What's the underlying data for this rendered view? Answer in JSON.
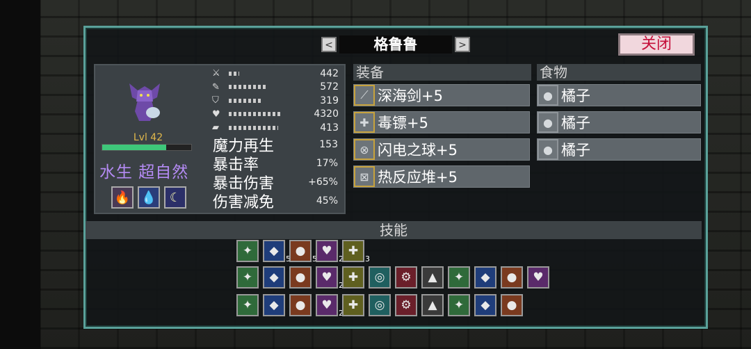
{
  "title": "格鲁鲁",
  "nav": {
    "prev": "<",
    "next": ">"
  },
  "close_label": "关闭",
  "character": {
    "level": "Lvl 42",
    "hp_fraction": 0.72,
    "traits": "水生 超自然",
    "stats": [
      {
        "icon": "sword-icon",
        "value": "442",
        "fill": 0.15
      },
      {
        "icon": "wrench-icon",
        "value": "572",
        "fill": 0.55
      },
      {
        "icon": "shield-icon",
        "value": "319",
        "fill": 0.45
      },
      {
        "icon": "heart-icon",
        "value": "4320",
        "fill": 0.75
      },
      {
        "icon": "boot-icon",
        "value": "413",
        "fill": 0.7
      }
    ],
    "extra_stats": [
      {
        "label": "魔力再生",
        "value": "153"
      },
      {
        "label": "暴击率",
        "value": "17%"
      },
      {
        "label": "暴击伤害",
        "value": "+65%"
      },
      {
        "label": "伤害减免",
        "value": "45%"
      }
    ]
  },
  "equipment": {
    "header": "装备",
    "items": [
      "深海剑+5",
      "毒镖+5",
      "闪电之球+5",
      "热反应堆+5"
    ]
  },
  "food": {
    "header": "食物",
    "items": [
      "橘子",
      "橘子",
      "橘子"
    ]
  },
  "skills": {
    "header": "技能",
    "row1": [
      {
        "icon": "slash-icon",
        "count": ""
      },
      {
        "icon": "rain-icon",
        "count": "5"
      },
      {
        "icon": "orb-icon",
        "count": "5"
      },
      {
        "icon": "fire-beam-icon",
        "count": "2"
      },
      {
        "icon": "wave-icon",
        "count": "3"
      }
    ],
    "row2": [
      {
        "icon": "blade-icon",
        "count": ""
      },
      {
        "icon": "heart-skull-icon",
        "count": ""
      },
      {
        "icon": "double-heart-icon",
        "count": ""
      },
      {
        "icon": "green-heart-icon",
        "count": "2"
      },
      {
        "icon": "blue-heart-icon",
        "count": ""
      },
      {
        "icon": "hourglass-orange-icon",
        "count": ""
      },
      {
        "icon": "hourglass-green-icon",
        "count": ""
      },
      {
        "icon": "blue-orbs-icon",
        "count": ""
      },
      {
        "icon": "green-figure-icon",
        "count": ""
      },
      {
        "icon": "green-heart-small-icon",
        "count": ""
      },
      {
        "icon": "red-sword-icon",
        "count": ""
      },
      {
        "icon": "shield-heart-icon",
        "count": ""
      }
    ],
    "row3": [
      {
        "icon": "red-dot-icon",
        "count": ""
      },
      {
        "icon": "blue-bag-icon",
        "count": ""
      },
      {
        "icon": "yellow-ring-icon",
        "count": ""
      },
      {
        "icon": "green-gear-icon",
        "count": "2"
      },
      {
        "icon": "red-diamond-icon",
        "count": ""
      },
      {
        "icon": "cyan-ring-icon",
        "count": ""
      },
      {
        "icon": "green-demon-icon",
        "count": ""
      },
      {
        "icon": "red-blob-icon",
        "count": ""
      },
      {
        "icon": "arrow-up-icon",
        "count": ""
      },
      {
        "icon": "purple-dots-icon",
        "count": ""
      },
      {
        "icon": "red-heart-icon",
        "count": ""
      }
    ]
  },
  "colors": {
    "panel_border": "#5aa19a",
    "close_text": "#c5103b",
    "trait_text": "#b58bf5",
    "equip_border": "#c7a23c"
  }
}
